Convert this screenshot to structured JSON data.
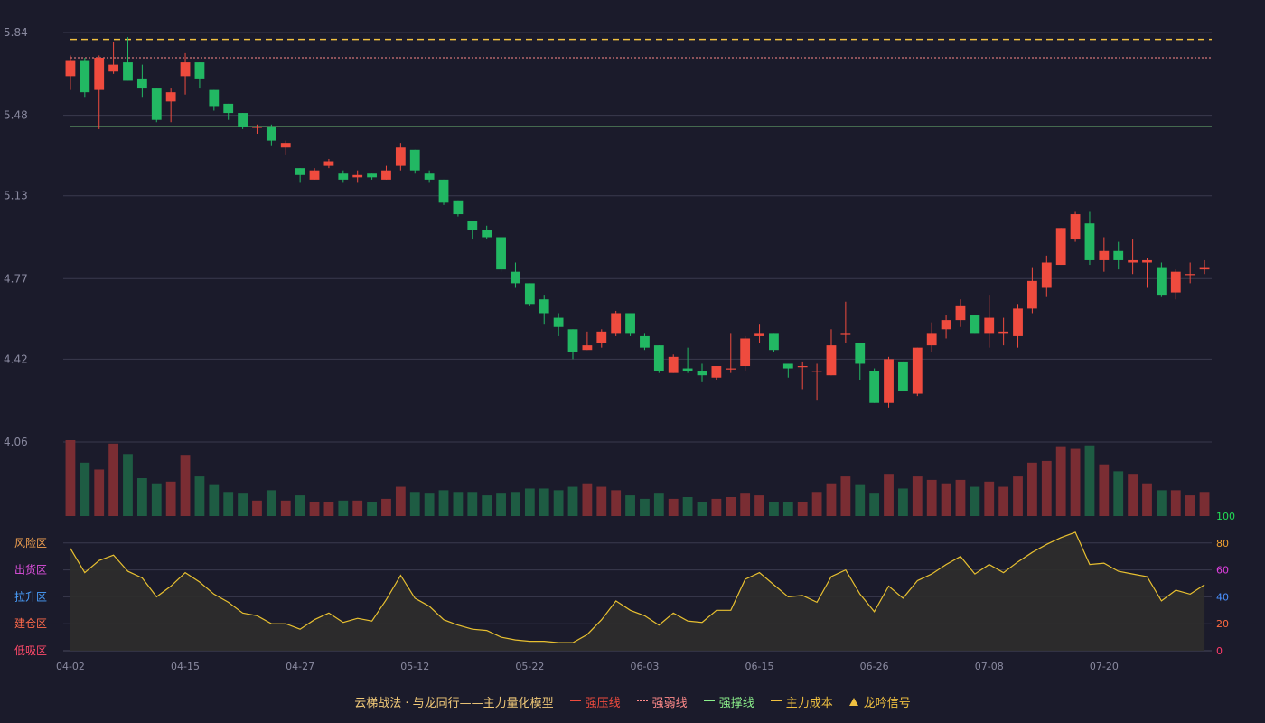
{
  "chart_data": [
    {
      "type": "candlestick",
      "title": "",
      "y_ticks": [
        5.84,
        5.48,
        5.13,
        4.77,
        4.42,
        4.06
      ],
      "ylim": [
        4.06,
        5.84
      ],
      "x_ticks": [
        "04-02",
        "04-15",
        "04-27",
        "05-12",
        "05-22",
        "06-03",
        "06-15",
        "06-26",
        "07-08",
        "07-20"
      ],
      "x_tick_index": [
        0,
        8,
        16,
        24,
        32,
        40,
        48,
        56,
        64,
        72
      ],
      "reference_lines": [
        {
          "name": "主力成本",
          "value": 5.81,
          "style": "dashed",
          "color": "#f0c040"
        },
        {
          "name": "强弱线",
          "value": 5.73,
          "style": "dotted",
          "color": "#ff8a8a"
        },
        {
          "name": "强撑线",
          "value": 5.43,
          "style": "solid",
          "color": "#8cf08c"
        }
      ],
      "candles": [
        [
          5.65,
          5.72,
          5.74,
          5.59
        ],
        [
          5.72,
          5.58,
          5.73,
          5.56
        ],
        [
          5.59,
          5.73,
          5.74,
          5.42
        ],
        [
          5.67,
          5.7,
          5.8,
          5.66
        ],
        [
          5.71,
          5.63,
          5.82,
          5.63
        ],
        [
          5.64,
          5.6,
          5.7,
          5.56
        ],
        [
          5.6,
          5.46,
          5.6,
          5.45
        ],
        [
          5.54,
          5.58,
          5.6,
          5.45
        ],
        [
          5.65,
          5.71,
          5.75,
          5.57
        ],
        [
          5.71,
          5.64,
          5.71,
          5.6
        ],
        [
          5.59,
          5.52,
          5.59,
          5.5
        ],
        [
          5.53,
          5.49,
          5.53,
          5.46
        ],
        [
          5.49,
          5.43,
          5.49,
          5.42
        ],
        [
          5.43,
          5.43,
          5.44,
          5.4
        ],
        [
          5.43,
          5.37,
          5.44,
          5.35
        ],
        [
          5.34,
          5.36,
          5.37,
          5.31
        ],
        [
          5.25,
          5.22,
          5.25,
          5.19
        ],
        [
          5.2,
          5.24,
          5.25,
          5.2
        ],
        [
          5.26,
          5.28,
          5.29,
          5.25
        ],
        [
          5.23,
          5.2,
          5.24,
          5.19
        ],
        [
          5.21,
          5.22,
          5.24,
          5.19
        ],
        [
          5.23,
          5.21,
          5.23,
          5.2
        ],
        [
          5.2,
          5.24,
          5.26,
          5.2
        ],
        [
          5.26,
          5.34,
          5.36,
          5.24
        ],
        [
          5.33,
          5.24,
          5.33,
          5.23
        ],
        [
          5.23,
          5.2,
          5.24,
          5.19
        ],
        [
          5.2,
          5.1,
          5.2,
          5.09
        ],
        [
          5.11,
          5.05,
          5.11,
          5.04
        ],
        [
          5.02,
          4.98,
          5.02,
          4.94
        ],
        [
          4.98,
          4.95,
          5.0,
          4.94
        ],
        [
          4.95,
          4.81,
          4.95,
          4.8
        ],
        [
          4.8,
          4.75,
          4.84,
          4.73
        ],
        [
          4.75,
          4.66,
          4.75,
          4.65
        ],
        [
          4.68,
          4.62,
          4.7,
          4.57
        ],
        [
          4.6,
          4.56,
          4.62,
          4.52
        ],
        [
          4.55,
          4.45,
          4.55,
          4.42
        ],
        [
          4.46,
          4.48,
          4.54,
          4.46
        ],
        [
          4.49,
          4.54,
          4.55,
          4.47
        ],
        [
          4.53,
          4.62,
          4.63,
          4.52
        ],
        [
          4.62,
          4.53,
          4.62,
          4.52
        ],
        [
          4.52,
          4.47,
          4.53,
          4.46
        ],
        [
          4.48,
          4.37,
          4.48,
          4.36
        ],
        [
          4.36,
          4.43,
          4.44,
          4.36
        ],
        [
          4.38,
          4.37,
          4.47,
          4.36
        ],
        [
          4.37,
          4.35,
          4.4,
          4.32
        ],
        [
          4.34,
          4.39,
          4.39,
          4.33
        ],
        [
          4.38,
          4.38,
          4.53,
          4.36
        ],
        [
          4.39,
          4.51,
          4.52,
          4.37
        ],
        [
          4.52,
          4.53,
          4.57,
          4.49
        ],
        [
          4.53,
          4.46,
          4.53,
          4.45
        ],
        [
          4.4,
          4.38,
          4.4,
          4.34
        ],
        [
          4.39,
          4.39,
          4.41,
          4.29
        ],
        [
          4.37,
          4.37,
          4.4,
          4.24
        ],
        [
          4.35,
          4.48,
          4.55,
          4.35
        ],
        [
          4.53,
          4.53,
          4.67,
          4.49
        ],
        [
          4.49,
          4.4,
          4.49,
          4.33
        ],
        [
          4.37,
          4.23,
          4.38,
          4.23
        ],
        [
          4.23,
          4.42,
          4.43,
          4.21
        ],
        [
          4.41,
          4.28,
          4.41,
          4.28
        ],
        [
          4.27,
          4.47,
          4.47,
          4.26
        ],
        [
          4.48,
          4.53,
          4.58,
          4.45
        ],
        [
          4.55,
          4.59,
          4.61,
          4.51
        ],
        [
          4.59,
          4.65,
          4.68,
          4.56
        ],
        [
          4.61,
          4.53,
          4.61,
          4.53
        ],
        [
          4.53,
          4.6,
          4.7,
          4.47
        ],
        [
          4.53,
          4.54,
          4.6,
          4.48
        ],
        [
          4.52,
          4.64,
          4.66,
          4.47
        ],
        [
          4.64,
          4.76,
          4.82,
          4.62
        ],
        [
          4.73,
          4.84,
          4.87,
          4.69
        ],
        [
          4.83,
          4.99,
          4.99,
          4.83
        ],
        [
          4.94,
          5.05,
          5.06,
          4.93
        ],
        [
          5.01,
          4.85,
          5.06,
          4.83
        ],
        [
          4.85,
          4.89,
          4.95,
          4.8
        ],
        [
          4.89,
          4.85,
          4.93,
          4.81
        ],
        [
          4.84,
          4.85,
          4.94,
          4.79
        ],
        [
          4.84,
          4.85,
          4.86,
          4.73
        ],
        [
          4.82,
          4.7,
          4.84,
          4.69
        ],
        [
          4.71,
          4.8,
          4.81,
          4.68
        ],
        [
          4.79,
          4.79,
          4.84,
          4.75
        ],
        [
          4.81,
          4.82,
          4.85,
          4.79
        ]
      ],
      "volume": [
        44,
        31,
        27,
        42,
        36,
        22,
        19,
        20,
        35,
        23,
        18,
        14,
        13,
        9,
        15,
        9,
        12,
        8,
        8,
        9,
        9,
        8,
        10,
        17,
        14,
        13,
        15,
        14,
        14,
        12,
        13,
        14,
        16,
        16,
        15,
        17,
        19,
        17,
        15,
        12,
        10,
        13,
        10,
        11,
        8,
        10,
        11,
        13,
        12,
        8,
        8,
        8,
        14,
        19,
        23,
        18,
        13,
        24,
        16,
        23,
        21,
        19,
        21,
        17,
        20,
        17,
        23,
        31,
        32,
        40,
        39,
        41,
        30,
        26,
        24,
        19,
        15,
        15,
        12,
        14
      ]
    },
    {
      "type": "area",
      "title": "",
      "ylim": [
        0,
        100
      ],
      "y_ticks": [
        0,
        20,
        40,
        60,
        80,
        100
      ],
      "zones": [
        "风险区",
        "出货区",
        "拉升区",
        "建仓区",
        "低吸区"
      ],
      "series": [
        {
          "name": "",
          "values": [
            76,
            58,
            67,
            71,
            59,
            54,
            40,
            48,
            58,
            51,
            42,
            36,
            28,
            26,
            20,
            20,
            16,
            23,
            28,
            21,
            24,
            22,
            38,
            56,
            39,
            33,
            23,
            19,
            16,
            15,
            10,
            8,
            7,
            7,
            6,
            6,
            12,
            23,
            37,
            30,
            26,
            19,
            28,
            22,
            21,
            30,
            30,
            53,
            58,
            49,
            40,
            41,
            36,
            55,
            60,
            42,
            29,
            48,
            39,
            52,
            57,
            64,
            70,
            57,
            64,
            58,
            66,
            73,
            79,
            84,
            88,
            64,
            65,
            59,
            57,
            55,
            37,
            45,
            42,
            49
          ]
        }
      ]
    }
  ],
  "legend": {
    "title": "云梯战法 · 与龙同行——主力量化模型",
    "items": [
      {
        "label": "强压线",
        "color": "#ef4b3e",
        "style": "solid"
      },
      {
        "label": "强弱线",
        "color": "#ff8a8a",
        "style": "dotted"
      },
      {
        "label": "强撑线",
        "color": "#8cf08c",
        "style": "solid"
      },
      {
        "label": "主力成本",
        "color": "#f0c040",
        "style": "dashed"
      },
      {
        "label": "龙吟信号",
        "color": "#f0c040",
        "style": "triangle"
      }
    ]
  },
  "colors": {
    "bg": "#1b1b2b",
    "grid": "#3a3a4e",
    "axis_text": "#8a8aa0",
    "up": "#ef4b3e",
    "down": "#22b863",
    "vol_up": "#7a2d33",
    "vol_down": "#1e5c43",
    "line": "#e8c030",
    "area_fill": "#2f2d2c",
    "zone_colors": [
      "#f0a050",
      "#e050e0",
      "#4aa0ff",
      "#ff6a4a",
      "#ff4a6a"
    ],
    "right_tick_colors": [
      "#22dd55",
      "#f0a030",
      "#e040e0",
      "#4a90ff",
      "#ff6a40",
      "#ff3a6a"
    ]
  }
}
